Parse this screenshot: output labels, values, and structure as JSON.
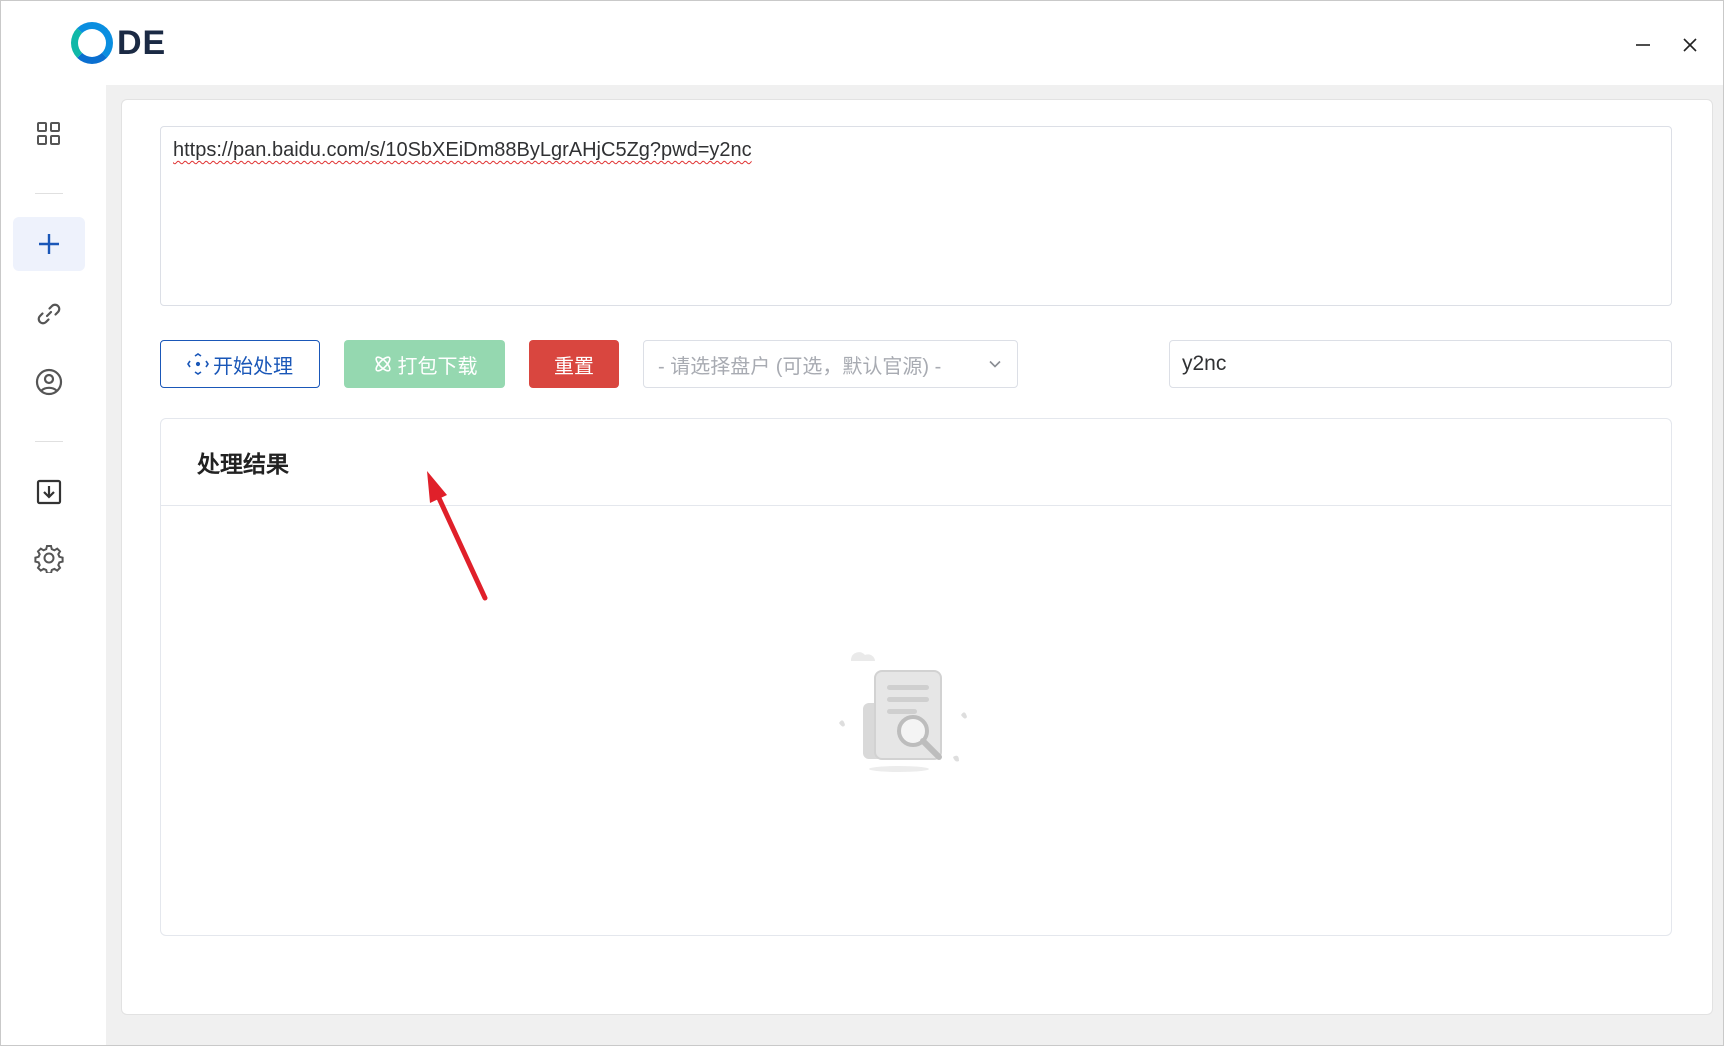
{
  "app": {
    "logo_text": "DE"
  },
  "window_controls": {
    "minimize_icon": "minimize-icon",
    "close_icon": "close-icon"
  },
  "sidebar": {
    "items": [
      {
        "name": "dashboard",
        "icon": "grid-icon",
        "active": false
      },
      {
        "name": "new-task",
        "icon": "plus-icon",
        "active": true
      },
      {
        "name": "links",
        "icon": "link-icon",
        "active": false
      },
      {
        "name": "account",
        "icon": "user-circle-icon",
        "active": false
      },
      {
        "name": "downloads",
        "icon": "download-icon",
        "active": false
      },
      {
        "name": "settings",
        "icon": "gear-icon",
        "active": false
      }
    ]
  },
  "main": {
    "url_input": {
      "value": "https://pan.baidu.com/s/10SbXEiDm88ByLgrAHjC5Zg?pwd=y2nc"
    },
    "toolbar": {
      "start_label": "开始处理",
      "pack_label": "打包下载",
      "reset_label": "重置",
      "select_placeholder": "- 请选择盘户 (可选，默认官源) -",
      "password_value": "y2nc"
    },
    "results": {
      "title": "处理结果"
    }
  },
  "colors": {
    "primary": "#1a57b8",
    "success_disabled": "#95d8b0",
    "danger": "#d9463f",
    "annotation_arrow": "#e0202a"
  }
}
